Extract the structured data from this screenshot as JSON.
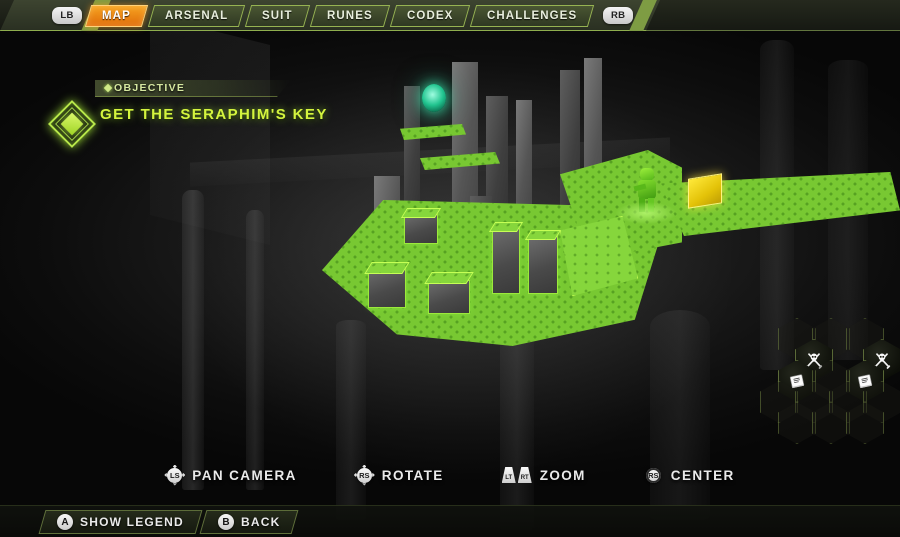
{
  "topbar": {
    "left_bumper": "LB",
    "right_bumper": "RB",
    "tabs": [
      {
        "label": "MAP",
        "active": true
      },
      {
        "label": "ARSENAL",
        "active": false
      },
      {
        "label": "SUIT",
        "active": false
      },
      {
        "label": "RUNES",
        "active": false
      },
      {
        "label": "CODEX",
        "active": false
      },
      {
        "label": "CHALLENGES",
        "active": false
      }
    ]
  },
  "objective": {
    "header": "OBJECTIVE",
    "text": "GET THE SERAPHIM'S KEY",
    "icon": "diamond-objective-icon"
  },
  "hints": [
    {
      "icon": "left-stick-icon",
      "button": "LS",
      "label": "PAN CAMERA"
    },
    {
      "icon": "right-stick-icon",
      "button": "RS",
      "label": "ROTATE"
    },
    {
      "icon": "trigger-icons",
      "button": "LT",
      "button2": "RT",
      "label": "ZOOM"
    },
    {
      "icon": "right-stick-press-icon",
      "button": "RS",
      "label": "CENTER"
    }
  ],
  "bottombar": {
    "buttons": [
      {
        "face": "A",
        "label": "SHOW LEGEND"
      },
      {
        "face": "B",
        "label": "BACK"
      }
    ]
  },
  "hexgrid": {
    "icons": [
      {
        "name": "codex-book-icon",
        "glyph": "book"
      },
      {
        "name": "combat-skull-icon",
        "glyph": "skull-swords"
      },
      {
        "name": "codex-book-icon",
        "glyph": "book"
      },
      {
        "name": "combat-skull-icon",
        "glyph": "skull-swords"
      }
    ]
  },
  "map": {
    "player_marker": "player-character-marker",
    "objective_marker": "objective-crate-marker",
    "waypoint_marker": "waypoint-beacon-marker"
  },
  "colors": {
    "accent_orange": "#e8800f",
    "accent_green": "#9cea3c",
    "objective_yellow": "#d4f43e",
    "map_green": "#78c832",
    "bar_olive": "#8fae4e"
  }
}
